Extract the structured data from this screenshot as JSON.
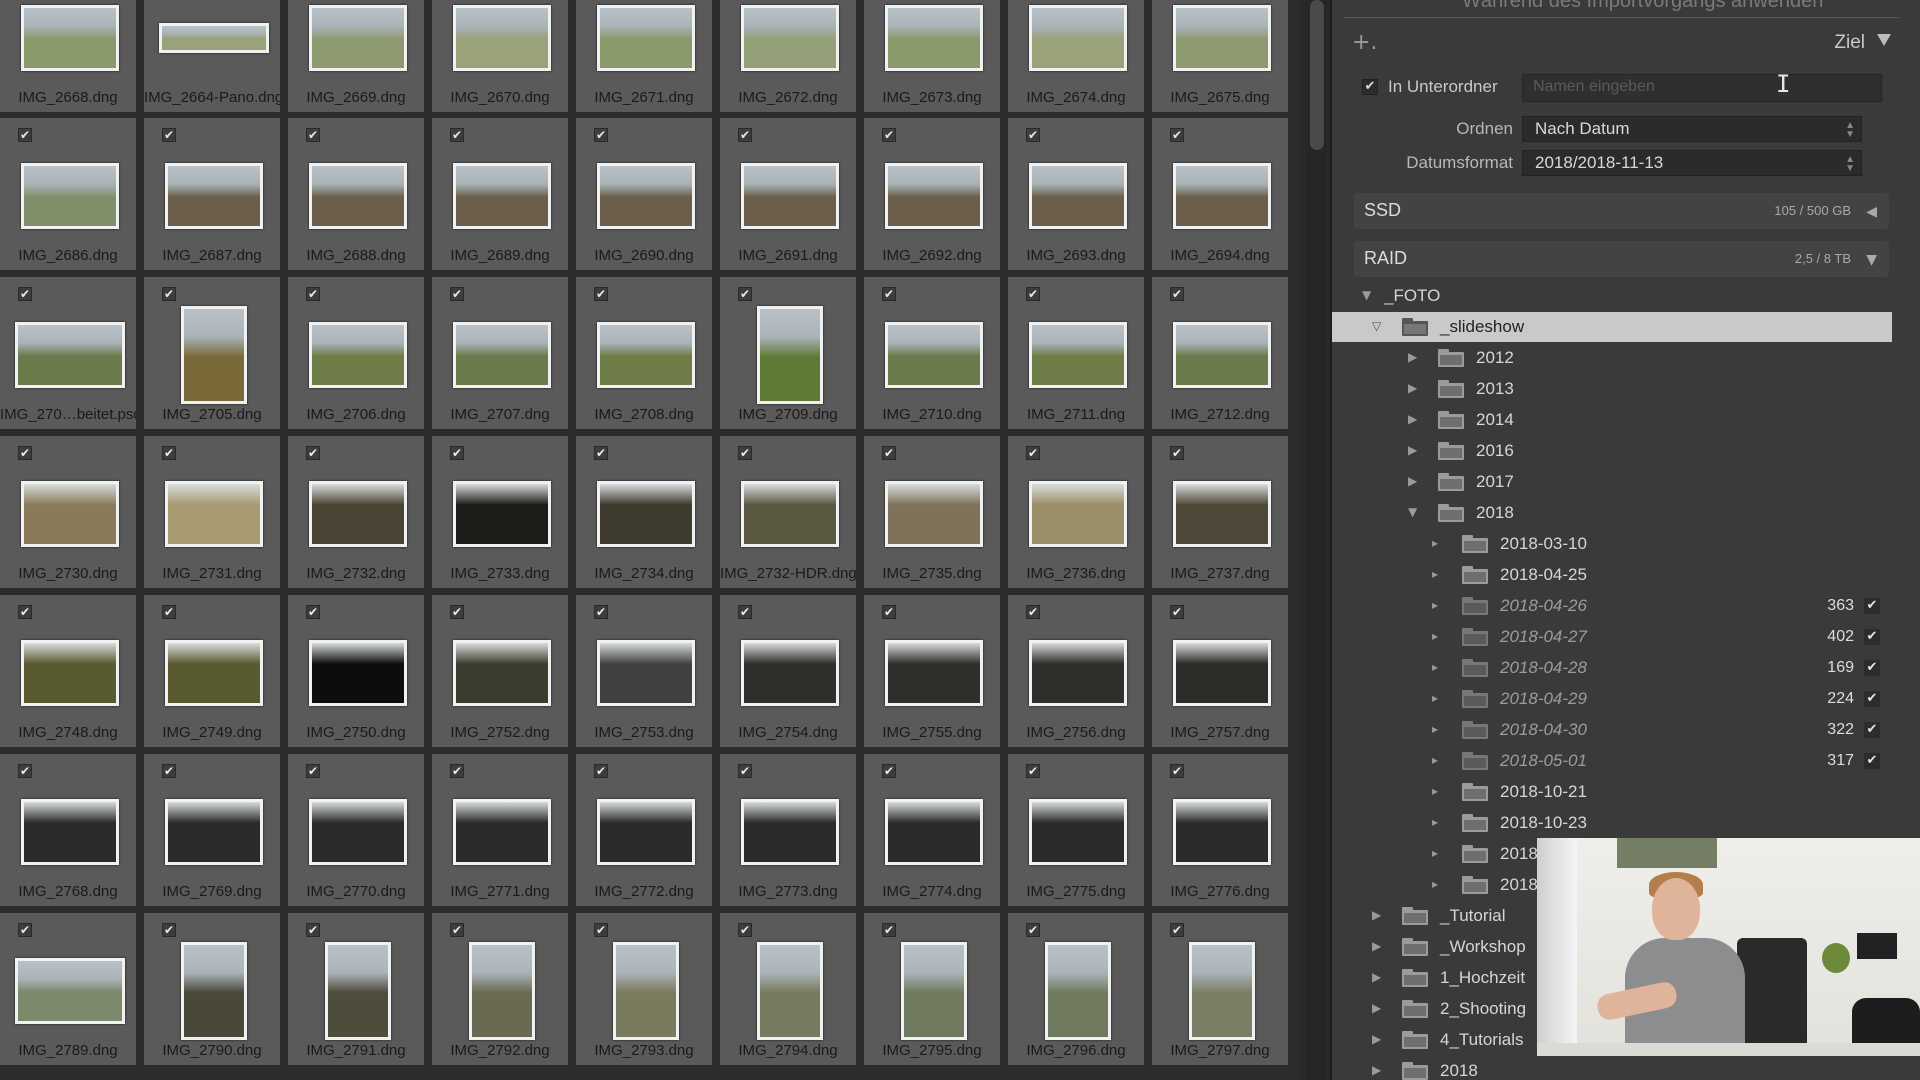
{
  "grid": {
    "rows": [
      [
        "IMG_2668.dng",
        "IMG_2664-Pano.dng",
        "IMG_2669.dng",
        "IMG_2670.dng",
        "IMG_2671.dng",
        "IMG_2672.dng",
        "IMG_2673.dng",
        "IMG_2674.dng",
        "IMG_2675.dng"
      ],
      [
        "IMG_2686.dng",
        "IMG_2687.dng",
        "IMG_2688.dng",
        "IMG_2689.dng",
        "IMG_2690.dng",
        "IMG_2691.dng",
        "IMG_2692.dng",
        "IMG_2693.dng",
        "IMG_2694.dng"
      ],
      [
        "IMG_270…beitet.psd",
        "IMG_2705.dng",
        "IMG_2706.dng",
        "IMG_2707.dng",
        "IMG_2708.dng",
        "IMG_2709.dng",
        "IMG_2710.dng",
        "IMG_2711.dng",
        "IMG_2712.dng"
      ],
      [
        "IMG_2730.dng",
        "IMG_2731.dng",
        "IMG_2732.dng",
        "IMG_2733.dng",
        "IMG_2734.dng",
        "IMG_2732-HDR.dng",
        "IMG_2735.dng",
        "IMG_2736.dng",
        "IMG_2737.dng"
      ],
      [
        "IMG_2748.dng",
        "IMG_2749.dng",
        "IMG_2750.dng",
        "IMG_2752.dng",
        "IMG_2753.dng",
        "IMG_2754.dng",
        "IMG_2755.dng",
        "IMG_2756.dng",
        "IMG_2757.dng"
      ],
      [
        "IMG_2768.dng",
        "IMG_2769.dng",
        "IMG_2770.dng",
        "IMG_2771.dng",
        "IMG_2772.dng",
        "IMG_2773.dng",
        "IMG_2774.dng",
        "IMG_2775.dng",
        "IMG_2776.dng"
      ],
      [
        "IMG_2789.dng",
        "IMG_2790.dng",
        "IMG_2791.dng",
        "IMG_2792.dng",
        "IMG_2793.dng",
        "IMG_2794.dng",
        "IMG_2795.dng",
        "IMG_2796.dng",
        "IMG_2797.dng"
      ]
    ],
    "check_glyph": "✔"
  },
  "panel": {
    "top_hint": "Während des Importvorgangs anwenden",
    "plus": "+.",
    "ziel": "Ziel",
    "subfolder": {
      "label": "In Unterordner",
      "placeholder": "Namen eingeben",
      "checked": true
    },
    "ordnen": {
      "label": "Ordnen",
      "value": "Nach Datum"
    },
    "datumsformat": {
      "label": "Datumsformat",
      "value": "2018/2018-11-13"
    },
    "volumes": [
      {
        "name": "SSD",
        "size": "105 / 500 GB"
      },
      {
        "name": "RAID",
        "size": "2,5 / 8 TB"
      }
    ],
    "tree": [
      {
        "label": "_FOTO",
        "level": 0,
        "disc": "▼",
        "folder": false
      },
      {
        "label": "_slideshow",
        "level": 1,
        "disc": "▽",
        "folder": true,
        "selected": true
      },
      {
        "label": "2012",
        "level": 2,
        "disc": "▶",
        "folder": true
      },
      {
        "label": "2013",
        "level": 2,
        "disc": "▶",
        "folder": true
      },
      {
        "label": "2014",
        "level": 2,
        "disc": "▶",
        "folder": true
      },
      {
        "label": "2016",
        "level": 2,
        "disc": "▶",
        "folder": true
      },
      {
        "label": "2017",
        "level": 2,
        "disc": "▶",
        "folder": true
      },
      {
        "label": "2018",
        "level": 2,
        "disc": "▼",
        "folder": true
      },
      {
        "label": "2018-03-10",
        "level": 3,
        "disc": "▸",
        "folder": true
      },
      {
        "label": "2018-04-25",
        "level": 3,
        "disc": "▸",
        "folder": true
      },
      {
        "label": "2018-04-26",
        "level": 3,
        "disc": "▸",
        "folder": true,
        "new": true,
        "count": "363"
      },
      {
        "label": "2018-04-27",
        "level": 3,
        "disc": "▸",
        "folder": true,
        "new": true,
        "count": "402"
      },
      {
        "label": "2018-04-28",
        "level": 3,
        "disc": "▸",
        "folder": true,
        "new": true,
        "count": "169"
      },
      {
        "label": "2018-04-29",
        "level": 3,
        "disc": "▸",
        "folder": true,
        "new": true,
        "count": "224"
      },
      {
        "label": "2018-04-30",
        "level": 3,
        "disc": "▸",
        "folder": true,
        "new": true,
        "count": "322"
      },
      {
        "label": "2018-05-01",
        "level": 3,
        "disc": "▸",
        "folder": true,
        "new": true,
        "count": "317"
      },
      {
        "label": "2018-10-21",
        "level": 3,
        "disc": "▸",
        "folder": true
      },
      {
        "label": "2018-10-23",
        "level": 3,
        "disc": "▸",
        "folder": true
      },
      {
        "label": "2018",
        "level": 3,
        "disc": "▸",
        "folder": true
      },
      {
        "label": "2018",
        "level": 3,
        "disc": "▸",
        "folder": true
      },
      {
        "label": "_Tutorial",
        "level": 1,
        "disc": "▶",
        "folder": true
      },
      {
        "label": "_Workshop",
        "level": 1,
        "disc": "▶",
        "folder": true
      },
      {
        "label": "1_Hochzeit",
        "level": 1,
        "disc": "▶",
        "folder": true
      },
      {
        "label": "2_Shooting",
        "level": 1,
        "disc": "▶",
        "folder": true
      },
      {
        "label": "4_Tutorials",
        "level": 1,
        "disc": "▶",
        "folder": true
      },
      {
        "label": "2018",
        "level": 1,
        "disc": "▶",
        "folder": true
      }
    ]
  },
  "colors": {
    "grid_bg": "#2c2c2c",
    "cell_bg": "#5a5a5a",
    "panel_bg": "#3a3a3a",
    "selected_row": "#c9c9c9"
  }
}
